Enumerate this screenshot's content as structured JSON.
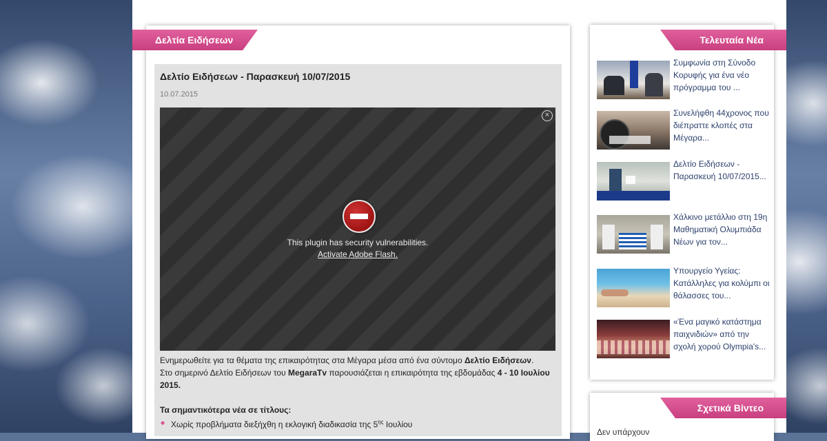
{
  "main": {
    "section_title": "Δελτία Ειδήσεων",
    "article": {
      "title": "Δελτίο Ειδήσεων - Παρασκευή 10/07/2015",
      "date": "10.07.2015",
      "plugin_message": "This plugin has security vulnerabilities.",
      "plugin_link": "Activate Adobe Flash.",
      "para1_text": "Ενημερωθείτε για τα θέματα της επικαιρότητας στα Μέγαρα μέσα από ένα σύντομο ",
      "para1_bold": "Δελτίο Ειδήσεων",
      "para1_end": ".",
      "para2_text": "Στο σημερινό Δελτίο Ειδήσεων του ",
      "para2_bold1": "MegaraTv",
      "para2_mid": " παρουσιάζεται η επικαιρότητα της εβδομάδας ",
      "para2_bold2": "4 - 10 Ιουλίου 2015.",
      "headlines_title": "Τα σημαντικότερα νέα σε τίτλους:",
      "bullet1_text": "Χωρίς προβλήματα διεξήχθη η εκλογική διαδικασία της 5",
      "bullet1_sup": "ης",
      "bullet1_end": " Ιουλίου"
    }
  },
  "sidebar": {
    "latest_title": "Τελευταία Νέα",
    "latest": [
      {
        "title": "Συμφωνία στη Σύνοδο Κορυφής για ένα νέο πρόγραμμα του ..."
      },
      {
        "title": "Συνελήφθη 44χρονος που διέπραττε κλοπές στα Μέγαρα..."
      },
      {
        "title": "Δελτίο Ειδήσεων - Παρασκευή 10/07/2015..."
      },
      {
        "title": "Χάλκινο μετάλλιο στη 19η Μαθηματική Ολυμπιάδα Νέων για τον..."
      },
      {
        "title": "Υπουργείο Υγείας: Κατάλληλες για κολύμπι οι θάλασσες του..."
      },
      {
        "title": "«Ένα μαγικό κατάστημα παιχνιδιών» από την σχολή χορού Olympia's..."
      }
    ],
    "related_title": "Σχετικά Βίντεο",
    "related_text": "Δεν υπάρχουν"
  },
  "icons": {
    "close": "close-icon",
    "blocked_plugin": "blocked-plugin-icon",
    "bullet": "diamond-bullet-icon"
  },
  "colors": {
    "accent": "#d94f8e",
    "link": "#2b3f6c"
  }
}
